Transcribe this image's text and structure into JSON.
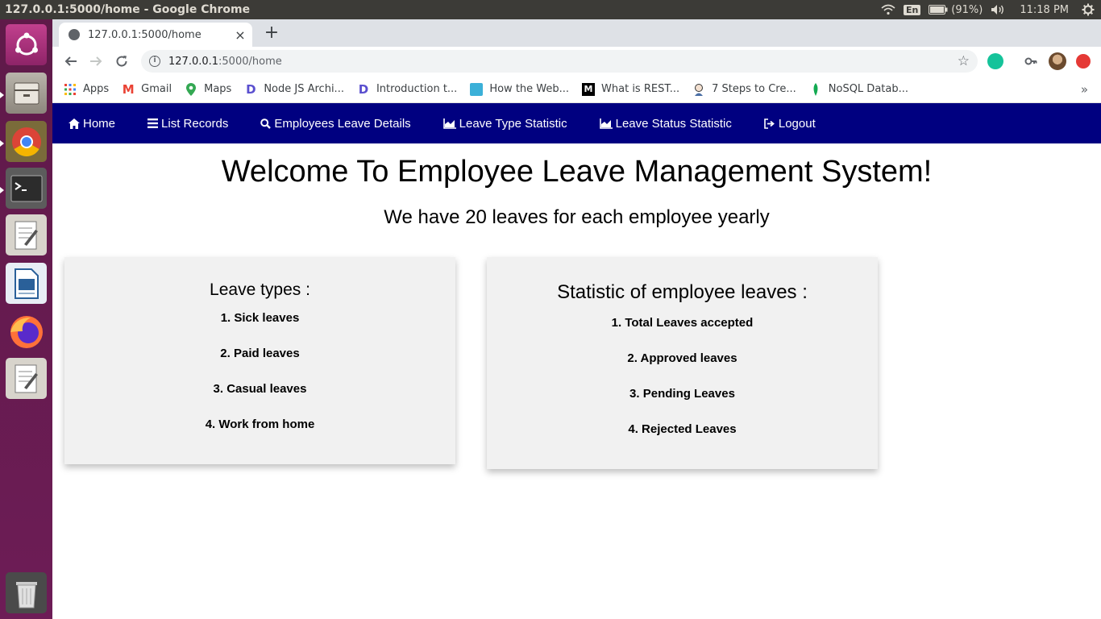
{
  "os": {
    "window_title": "127.0.0.1:5000/home - Google Chrome",
    "keyboard": "En",
    "battery": "(91%)",
    "time": "11:18 PM"
  },
  "browser": {
    "tab_title": "127.0.0.1:5000/home",
    "url_host": "127.0.0.1",
    "url_rest": ":5000/home",
    "bookmarks": [
      {
        "label": "Apps",
        "icon": "apps-grid-icon"
      },
      {
        "label": "Gmail",
        "icon": "gmail-icon"
      },
      {
        "label": "Maps",
        "icon": "maps-icon"
      },
      {
        "label": "Node JS Archi...",
        "icon": "dev-icon"
      },
      {
        "label": "Introduction t...",
        "icon": "dev-icon"
      },
      {
        "label": "How the Web...",
        "icon": "site-icon"
      },
      {
        "label": "What is REST...",
        "icon": "medium-icon"
      },
      {
        "label": "7 Steps to Cre...",
        "icon": "avatar-icon"
      },
      {
        "label": "NoSQL Datab...",
        "icon": "mongodb-leaf-icon"
      }
    ]
  },
  "nav": {
    "home": "Home",
    "list_records": "List Records",
    "employees_leave_details": "Employees Leave Details",
    "leave_type_statistic": "Leave Type Statistic",
    "leave_status_statistic": "Leave Status Statistic",
    "logout": "Logout",
    "bg_color": "#000080"
  },
  "main": {
    "title": "Welcome To Employee Leave Management System!",
    "subtitle": "We have 20 leaves for each employee yearly",
    "leave_types": {
      "heading": "Leave types :",
      "items": [
        "1. Sick leaves",
        "2. Paid leaves",
        "3. Casual leaves",
        "4. Work from home"
      ]
    },
    "statistics": {
      "heading": "Statistic of employee leaves :",
      "items": [
        "1. Total Leaves accepted",
        "2. Approved leaves",
        "3. Pending Leaves",
        "4. Rejected Leaves"
      ]
    }
  }
}
